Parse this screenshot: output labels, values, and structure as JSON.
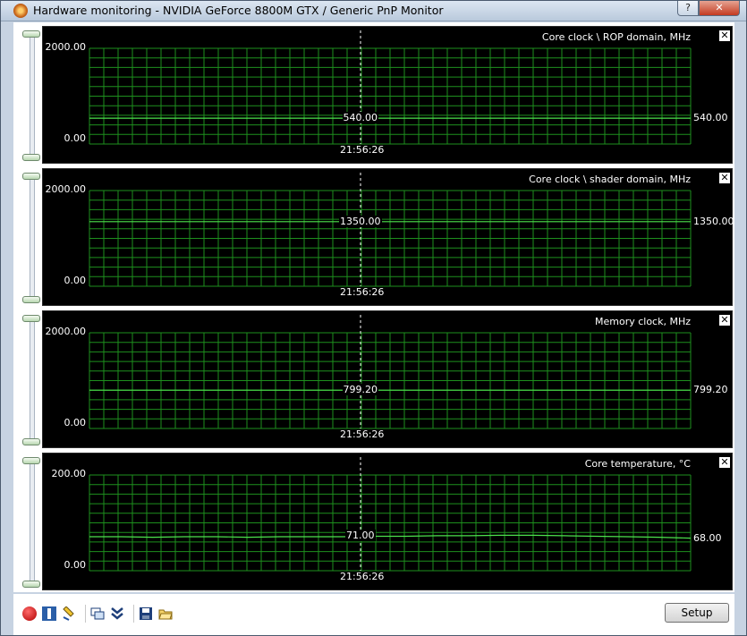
{
  "window": {
    "title": "Hardware monitoring - NVIDIA GeForce 8800M GTX / Generic PnP Monitor",
    "help_label": "?",
    "close_label": "✕"
  },
  "panels": [
    {
      "title": "Core clock \\ ROP domain, MHz",
      "max_label": "2000.00",
      "min_label": "0.00",
      "current_label": "540.00",
      "right_label": "540.00",
      "time": "21:56:26",
      "range": [
        0,
        2000
      ],
      "values": [
        540,
        540,
        540,
        540,
        540,
        540,
        540,
        540
      ],
      "close_label": "✕"
    },
    {
      "title": "Core clock \\ shader domain, MHz",
      "max_label": "2000.00",
      "min_label": "0.00",
      "current_label": "1350.00",
      "right_label": "1350.00",
      "time": "21:56:26",
      "range": [
        0,
        2000
      ],
      "values": [
        1350,
        1350,
        1350,
        1350,
        1350,
        1350,
        1350,
        1350
      ],
      "close_label": "✕"
    },
    {
      "title": "Memory clock, MHz",
      "max_label": "2000.00",
      "min_label": "0.00",
      "current_label": "799.20",
      "right_label": "799.20",
      "time": "21:56:26",
      "range": [
        0,
        2000
      ],
      "values": [
        799.2,
        799.2,
        799.2,
        799.2,
        799.2,
        799.2,
        799.2,
        799.2
      ],
      "close_label": "✕"
    },
    {
      "title": "Core temperature, °C",
      "max_label": "200.00",
      "min_label": "0.00",
      "current_label": "71.00",
      "right_label": "68.00",
      "time": "21:56:26",
      "range": [
        0,
        200
      ],
      "values": [
        71,
        71,
        70,
        71,
        71,
        70,
        71,
        71,
        71,
        72,
        72,
        73,
        73,
        74,
        74,
        73,
        72,
        71,
        70,
        68
      ],
      "close_label": "✕"
    }
  ],
  "toolbar": {
    "setup_label": "Setup",
    "icons": [
      "record-icon",
      "pause-icon",
      "highlight-icon",
      "windows-icon",
      "collapse-icon",
      "save-icon",
      "open-folder-icon"
    ]
  },
  "colors": {
    "grid": "#1e8f1e",
    "line": "#4de24d",
    "background": "#000000"
  }
}
